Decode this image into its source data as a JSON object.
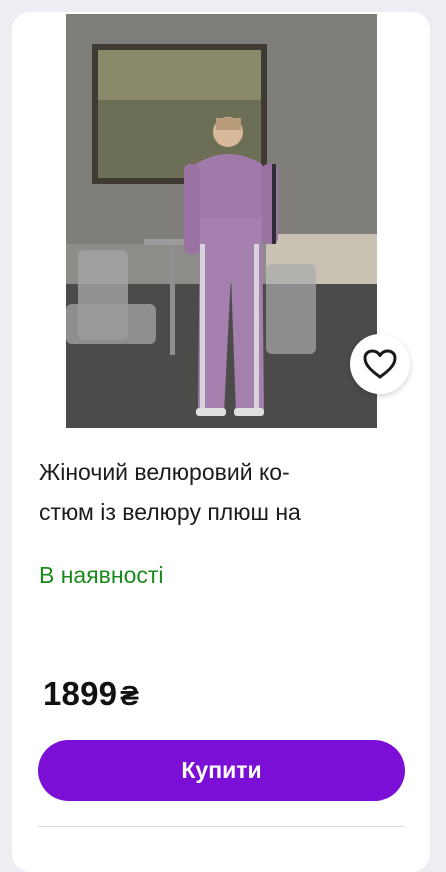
{
  "product": {
    "image_alt_icon": "product-photo",
    "title_line1": "Жіночий велюровий ко-",
    "title_line2": "стюм із велюру плюш на",
    "availability": "В наявності",
    "price_value": "1899",
    "price_currency": "₴",
    "buy_label": "Купити",
    "favorite_icon": "heart-icon"
  },
  "colors": {
    "accent": "#7b0fd6",
    "in_stock": "#1b8a1b",
    "card_bg": "#ffffff",
    "page_bg": "#eceef3"
  }
}
